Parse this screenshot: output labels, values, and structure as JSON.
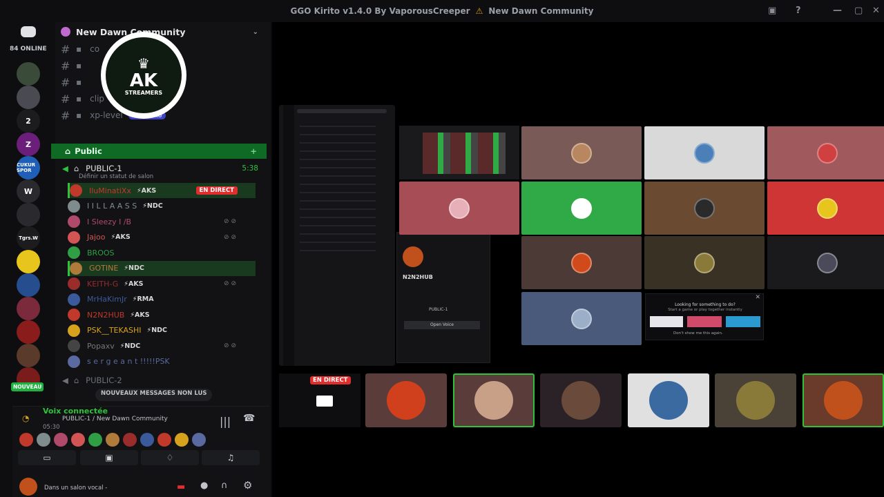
{
  "window": {
    "title": "GGO Kirito v1.4.0 By VaporousCreeper",
    "server_title": "New Dawn Community"
  },
  "guilds": {
    "online": "84 ONLINE",
    "items": [
      {
        "label": "",
        "color": "#3a4b3a"
      },
      {
        "label": "",
        "color": "#4a4a52"
      },
      {
        "label": "2",
        "color": "#1c1c1f"
      },
      {
        "label": "Z",
        "color": "#6b1f7a"
      },
      {
        "label": "CUKUR SPOR",
        "color": "#1f5fb8"
      },
      {
        "label": "W",
        "color": "#2a2a2e"
      },
      {
        "label": "",
        "color": "#2a2a2e"
      },
      {
        "label": "Tgrs.W",
        "color": "#1c1c1f"
      },
      {
        "label": "",
        "color": "#e7c51c"
      },
      {
        "label": "",
        "color": "#264e8f"
      },
      {
        "label": "",
        "color": "#7a2a3a"
      },
      {
        "label": "",
        "color": "#8a1c1c"
      },
      {
        "label": "",
        "color": "#5a3a2a"
      },
      {
        "label": "",
        "color": "#7a1c1c"
      }
    ],
    "nouveau": "NOUVEAU"
  },
  "sidebar": {
    "server_name": "New Dawn Community",
    "channels": [
      {
        "name": "co"
      },
      {
        "name": ""
      },
      {
        "name": ""
      },
      {
        "name": "clip"
      },
      {
        "name": "xp-level",
        "badge": "NOUVEAU"
      }
    ],
    "category": "Public",
    "voice1": {
      "name": "PUBLIC-1",
      "time": "5:38",
      "status": "Définir un statut de salon"
    },
    "members": [
      {
        "name": "IluMinatiXx",
        "tag": "AKS",
        "live": "EN DIRECT",
        "hl": true,
        "color": "#c0392b"
      },
      {
        "name": "I I L L A A S S",
        "tag": "NDC",
        "color": "#7f8c8d"
      },
      {
        "name": "I Sleezy I /B",
        "tag": "",
        "color": "#b04a6a",
        "muted": true
      },
      {
        "name": "Jajoo",
        "tag": "AKS",
        "color": "#d35454",
        "muted": true
      },
      {
        "name": "BROOS",
        "tag": "",
        "color": "#2f9e44"
      },
      {
        "name": "GOTINE",
        "tag": "NDC",
        "hl": true,
        "color": "#b07a3a"
      },
      {
        "name": "KEITH-G",
        "tag": "AKS",
        "color": "#9b2c2c",
        "muted": true
      },
      {
        "name": "MrHaKimJr",
        "tag": "RMA",
        "color": "#3a5a9b"
      },
      {
        "name": "N2N2HUB",
        "tag": "AKS",
        "color": "#c0392b"
      },
      {
        "name": "PSK__TEKASHI",
        "tag": "NDC",
        "color": "#d6a21e"
      },
      {
        "name": "Popaxv",
        "tag": "NDC",
        "color": "#444",
        "muted": true
      },
      {
        "name": "s e r g e a n t !!!!!PSK",
        "tag": "",
        "color": "#5a6aa0"
      }
    ],
    "voice2": {
      "name": "PUBLIC-2"
    },
    "new_messages": "NOUVEAUX MESSAGES NON LUS"
  },
  "voice_panel": {
    "status": "Voix connectée",
    "channel": "PUBLIC-1 / New Dawn Community",
    "timer": "05:30",
    "bottom_text": "Dans un salon vocal -"
  },
  "stage": {
    "tiles": [
      {
        "color": "#7a5a56",
        "ring": "#b9875f"
      },
      {
        "color": "#d9d9d9",
        "ring": "#4a7fb8"
      },
      {
        "color": "#a05a5e",
        "ring": "#d04040"
      },
      {
        "color": "#a74d55",
        "ring": "#e7b0b8"
      },
      {
        "color": "#2faa46",
        "ring": "#ffffff"
      },
      {
        "color": "#6b4a32",
        "ring": "#2a2a2a"
      },
      {
        "color": "#d03535",
        "ring": "#e7c51c"
      },
      {
        "color": "#4b3a35",
        "ring": "#d04a1c"
      },
      {
        "color": "#3a3125",
        "ring": "#8a7a3a"
      },
      {
        "color": "#1a1a1c",
        "ring": "#4a4a5a"
      },
      {
        "color": "#4a5a7a",
        "ring": "#9bb0c8"
      }
    ],
    "live": "EN DIRECT",
    "popup": {
      "title": "Looking for something to do?",
      "subtitle": "Start a game or play together instantly",
      "checkbox": "Don't show me this again."
    },
    "strip": [
      {
        "color": "#5a3d3a",
        "ring": "#d0401c"
      },
      {
        "color": "#5a3d3a",
        "ring": "#c8a088",
        "active": true
      },
      {
        "color": "#2a2226",
        "ring": "#6a4a3a"
      },
      {
        "color": "#e0e0e0",
        "ring": "#3a6aa0"
      },
      {
        "color": "#4a4236",
        "ring": "#8a7a3a"
      },
      {
        "color": "#6a3a2a",
        "ring": "#c0501c",
        "active": true
      }
    ],
    "profile": {
      "name": "N2N2HUB",
      "btn": "Open Voice",
      "channel": "PUBLIC-1"
    }
  },
  "logo": {
    "text": "AK",
    "sub": "STREAMERS"
  }
}
